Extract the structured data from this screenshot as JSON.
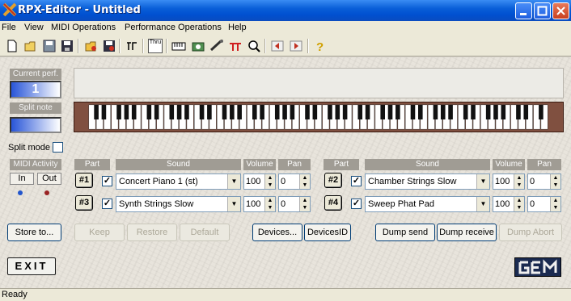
{
  "window": {
    "title": "RPX-Editor - Untitled",
    "logo_icon": "x-logo-icon",
    "minimize_icon": "minimize-icon",
    "maximize_icon": "maximize-icon",
    "close_icon": "close-icon"
  },
  "menu": [
    "File",
    "View",
    "MIDI Operations",
    "Performance Operations",
    "Help"
  ],
  "toolbar": {
    "tools": [
      "new-icon",
      "open-icon",
      "save-icon",
      "save-as-icon",
      "open-perf-icon",
      "save-perf-icon",
      "midi-thru-icon",
      "thru-icon",
      "keyboard-icon",
      "recorder-icon",
      "connect-icon",
      "split-icon",
      "search-icon",
      "prev-icon",
      "next-icon",
      "help-icon"
    ],
    "thru_text": "Thru"
  },
  "current_perf": {
    "label": "Current perf.",
    "value": "1"
  },
  "split_note": {
    "label": "Split note"
  },
  "split_mode": {
    "label": "Split mode",
    "checked": false
  },
  "midi_activity": {
    "label": "MIDI Activity",
    "in_label": "In",
    "out_label": "Out",
    "in_color": "#2255cc",
    "out_color": "#992222"
  },
  "headers": {
    "part": "Part",
    "sound": "Sound",
    "volume": "Volume",
    "pan": "Pan"
  },
  "parts": [
    {
      "button": "#1",
      "checked": true,
      "sound": "Concert Piano 1 (st)",
      "volume": "100",
      "pan": "0"
    },
    {
      "button": "#2",
      "checked": true,
      "sound": "Chamber Strings Slow",
      "volume": "100",
      "pan": "0"
    },
    {
      "button": "#3",
      "checked": true,
      "sound": "Synth Strings Slow",
      "volume": "100",
      "pan": "0"
    },
    {
      "button": "#4",
      "checked": true,
      "sound": "Sweep Phat Pad",
      "volume": "100",
      "pan": "0"
    }
  ],
  "buttons": {
    "store": "Store to...",
    "keep": "Keep",
    "restore": "Restore",
    "default": "Default",
    "devices": "Devices...",
    "devices_id": "DevicesID",
    "dump_send": "Dump send",
    "dump_receive": "Dump receive",
    "dump_abort": "Dump Abort",
    "exit": "EXIT"
  },
  "brand": {
    "logo": "GEM"
  },
  "status": {
    "text": "Ready"
  },
  "colors": {
    "title_bar": "#0a5fd8",
    "accent_blue": "#2855d8",
    "keyboard_wood": "#805040"
  },
  "keyboard": {
    "white_keys": 61
  }
}
